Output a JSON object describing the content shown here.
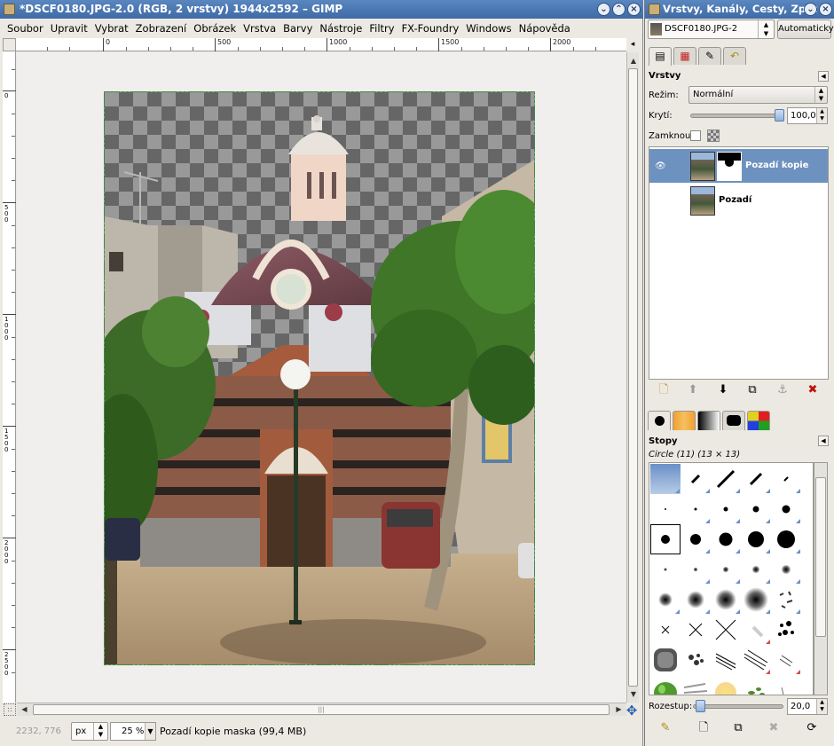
{
  "main_window": {
    "title": "*DSCF0180.JPG-2.0 (RGB, 2 vrstvy) 1944x2592 – GIMP",
    "menu": [
      "Soubor",
      "Upravit",
      "Vybrat",
      "Zobrazení",
      "Obrázek",
      "Vrstva",
      "Barvy",
      "Nástroje",
      "Filtry",
      "FX-Foundry",
      "Windows",
      "Nápověda"
    ],
    "ruler_h_labels": [
      "0",
      "500",
      "1000",
      "1500",
      "2000"
    ],
    "ruler_v_labels": [
      "0",
      "500",
      "1000",
      "1500",
      "2000",
      "2500"
    ],
    "status": {
      "coords": "2232, 776",
      "unit": "px",
      "zoom": "25 %",
      "message": "Pozadí kopie maska (99,4 MB)"
    }
  },
  "dock": {
    "title": "Vrstvy, Kanály, Cesty, Zpět",
    "image_select": "DSCF0180.JPG-2",
    "auto_button": "Automaticky",
    "layers_panel": {
      "title": "Vrstvy",
      "mode_label": "Režim:",
      "mode_value": "Normální",
      "opacity_label": "Krytí:",
      "opacity_value": "100,0",
      "opacity_fraction": 1.0,
      "lock_label": "Zamknout:",
      "layers": [
        {
          "name": "Pozadí kopie",
          "selected": true,
          "visible": true,
          "has_mask": true
        },
        {
          "name": "Pozadí",
          "selected": false,
          "visible": false,
          "has_mask": false
        }
      ]
    },
    "brushes_panel": {
      "title": "Stopy",
      "selected_info": "Circle (11) (13 × 13)",
      "spacing_label": "Rozestup:",
      "spacing_value": "20,0"
    }
  }
}
